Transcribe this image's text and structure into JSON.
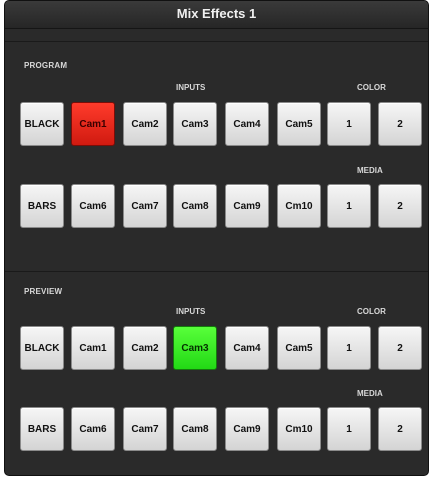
{
  "title": "Mix Effects 1",
  "program": {
    "label": "PROGRAM",
    "inputs_label": "INPUTS",
    "color_label": "COLOR",
    "media_label": "MEDIA",
    "row1": [
      "BLACK",
      "Cam1",
      "Cam2",
      "Cam3",
      "Cam4",
      "Cam5",
      "1",
      "2"
    ],
    "row2": [
      "BARS",
      "Cam6",
      "Cam7",
      "Cam8",
      "Cam9",
      "Cm10",
      "1",
      "2"
    ],
    "active": "Cam1",
    "active_color": "#e8231a"
  },
  "preview": {
    "label": "PREVIEW",
    "inputs_label": "INPUTS",
    "color_label": "COLOR",
    "media_label": "MEDIA",
    "row1": [
      "BLACK",
      "Cam1",
      "Cam2",
      "Cam3",
      "Cam4",
      "Cam5",
      "1",
      "2"
    ],
    "row2": [
      "BARS",
      "Cam6",
      "Cam7",
      "Cam8",
      "Cam9",
      "Cm10",
      "1",
      "2"
    ],
    "active": "Cam3",
    "active_color": "#3ef024"
  }
}
